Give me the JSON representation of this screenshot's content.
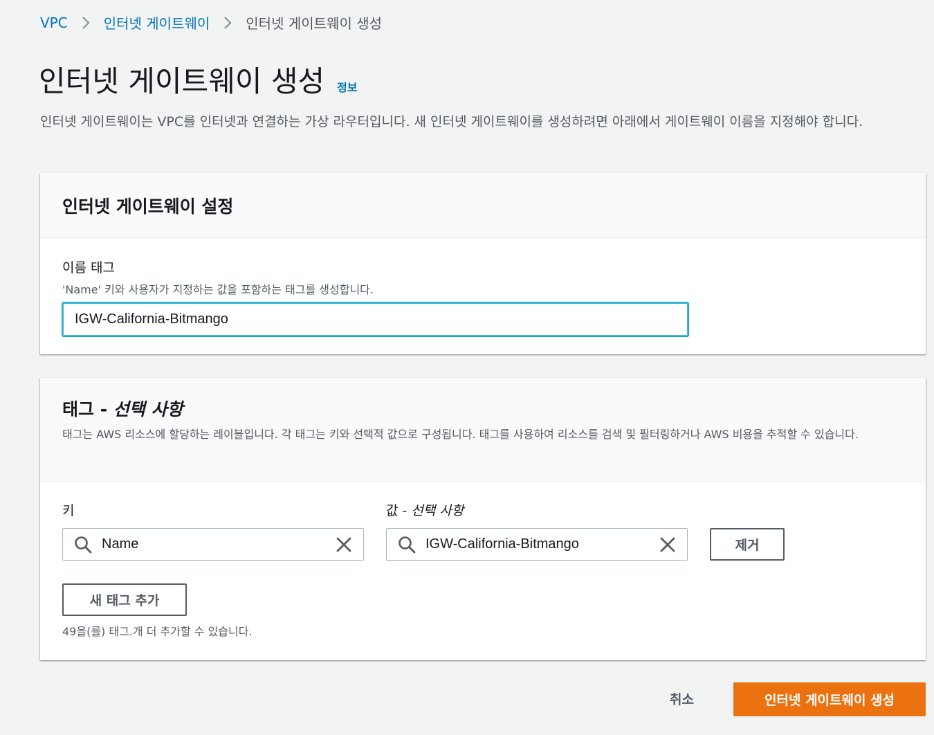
{
  "breadcrumb": {
    "items": [
      "VPC",
      "인터넷 게이트웨이"
    ],
    "current": "인터넷 게이트웨이 생성"
  },
  "header": {
    "title": "인터넷 게이트웨이 생성",
    "info_link": "정보",
    "description": "인터넷 게이트웨이는 VPC를 인터넷과 연결하는 가상 라우터입니다. 새 인터넷 게이트웨이를 생성하려면 아래에서 게이트웨이 이름을 지정해야 합니다."
  },
  "settings_panel": {
    "title": "인터넷 게이트웨이 설정",
    "name_tag_label": "이름 태그",
    "name_tag_desc": "'Name' 키와 사용자가 지정하는 값을 포함하는 태그를 생성합니다.",
    "name_tag_value": "IGW-California-Bitmango"
  },
  "tags_panel": {
    "title_main": "태그 - ",
    "title_optional": "선택 사항",
    "description": "태그는 AWS 리소스에 할당하는 레이블입니다. 각 태그는 키와 선택적 값으로 구성됩니다. 태그를 사용하여 리소스를 검색 및 필터링하거나 AWS 비용을 추적할 수 있습니다.",
    "key_label": "키",
    "value_label_main": "값 - ",
    "value_label_optional": "선택 사항",
    "key_value": "Name",
    "value_value": "IGW-California-Bitmango",
    "remove_label": "제거",
    "add_tag_label": "새 태그 추가",
    "limit_text": "49을(를) 태그.개 더 추가할 수 있습니다."
  },
  "footer": {
    "cancel_label": "취소",
    "create_label": "인터넷 게이트웨이 생성"
  },
  "colors": {
    "link": "#0073bb",
    "primary": "#ec7211",
    "focus": "#00a1c9"
  }
}
